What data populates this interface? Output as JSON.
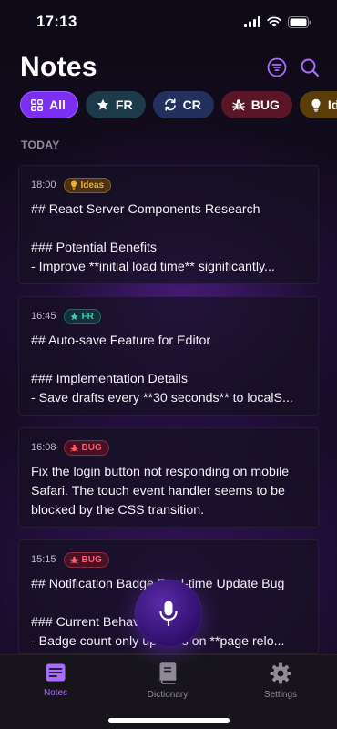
{
  "status_bar": {
    "time": "17:13"
  },
  "header": {
    "title": "Notes"
  },
  "filters": [
    {
      "label": "All",
      "icon": "grid-icon"
    },
    {
      "label": "FR",
      "icon": "star-icon"
    },
    {
      "label": "CR",
      "icon": "refresh-icon"
    },
    {
      "label": "BUG",
      "icon": "bug-icon"
    },
    {
      "label": "Ideas",
      "icon": "lightbulb-icon"
    }
  ],
  "section": {
    "label": "TODAY"
  },
  "notes": [
    {
      "time": "18:00",
      "tag": "Ideas",
      "lines": [
        "## React Server Components Research",
        "",
        "### Potential Benefits",
        "- Improve **initial load time** significantly..."
      ]
    },
    {
      "time": "16:45",
      "tag": "FR",
      "lines": [
        "## Auto-save Feature for Editor",
        "",
        "### Implementation Details",
        "- Save drafts every **30 seconds** to localS..."
      ]
    },
    {
      "time": "16:08",
      "tag": "BUG",
      "text": "Fix the login button not responding on mobile Safari. The touch event handler seems to be blocked by the CSS transition."
    },
    {
      "time": "15:15",
      "tag": "BUG",
      "lines": [
        "## Notification Badge Real-time Update Bug",
        "",
        "### Current Behavior",
        "- Badge count only updates on **page relo..."
      ]
    }
  ],
  "tab_bar": {
    "tabs": [
      {
        "label": "Notes",
        "icon": "notes-icon",
        "active": true
      },
      {
        "label": "Dictionary",
        "icon": "book-icon"
      },
      {
        "label": "Settings",
        "icon": "gear-icon"
      }
    ]
  },
  "colors": {
    "accent": "#7b2ff2",
    "ideas": "#f0ad2f",
    "fr": "#36d1b0",
    "bug": "#ff5c6c"
  }
}
